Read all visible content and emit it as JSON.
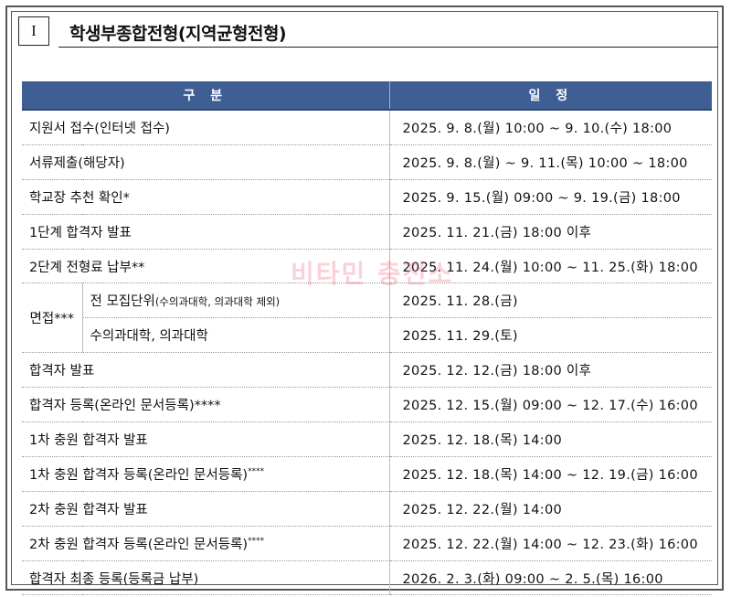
{
  "section": {
    "number": "I",
    "title": "학생부종합전형(지역균형전형)"
  },
  "table": {
    "headers": {
      "category": "구 분",
      "schedule": "일 정"
    },
    "rows": [
      {
        "category": "지원서 접수(인터넷 접수)",
        "schedule": "2025. 9. 8.(월) 10:00 ~ 9. 10.(수) 18:00"
      },
      {
        "category": "서류제출(해당자)",
        "schedule": "2025. 9. 8.(월) ~ 9. 11.(목) 10:00 ~ 18:00"
      },
      {
        "category": "학교장 추천 확인*",
        "schedule": "2025. 9. 15.(월) 09:00 ~ 9. 19.(금) 18:00"
      },
      {
        "category": "1단계 합격자 발표",
        "schedule": "2025. 11. 21.(금) 18:00 이후"
      },
      {
        "category": "2단계 전형료 납부**",
        "schedule": "2025. 11. 24.(월) 10:00 ~ 11. 25.(화) 18:00"
      },
      {
        "category": "합격자 발표",
        "schedule": "2025. 12. 12.(금) 18:00 이후"
      },
      {
        "category": "합격자 등록(온라인 문서등록)****",
        "schedule": "2025. 12. 15.(월) 09:00 ~ 12. 17.(수) 16:00"
      },
      {
        "category": "1차 충원 합격자 발표",
        "schedule": "2025. 12. 18.(목) 14:00"
      },
      {
        "category": "1차 충원 합격자 등록(온라인 문서등록)",
        "sup": "****",
        "schedule": "2025. 12. 18.(목) 14:00 ~ 12. 19.(금) 16:00"
      },
      {
        "category": "2차 충원 합격자 발표",
        "schedule": "2025. 12. 22.(월) 14:00"
      },
      {
        "category": "2차 충원 합격자 등록(온라인 문서등록)",
        "sup": "****",
        "schedule": "2025. 12. 22.(월) 14:00 ~ 12. 23.(화) 16:00"
      },
      {
        "category": "합격자 최종 등록(등록금 납부)",
        "schedule": "2026. 2. 3.(화) 09:00 ~ 2. 5.(목) 16:00"
      }
    ],
    "interview": {
      "label": "면접***",
      "sub": [
        {
          "label": "전 모집단위",
          "note": "(수의과대학, 의과대학 제외)",
          "schedule": "2025. 11. 28.(금)"
        },
        {
          "label": "수의과대학, 의과대학",
          "schedule": "2025. 11. 29.(토)"
        }
      ]
    }
  },
  "watermark": "비타민 충전소",
  "colors": {
    "header_bg": "#3f5f94",
    "header_text": "#ffffff",
    "watermark": "#f05a78"
  }
}
